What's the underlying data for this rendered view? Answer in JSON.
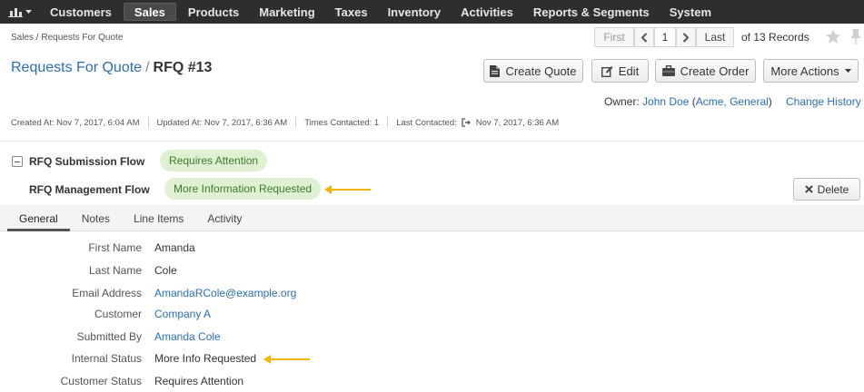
{
  "nav": {
    "logo_icon": "bar-chart-icon",
    "items": [
      "Customers",
      "Sales",
      "Products",
      "Marketing",
      "Taxes",
      "Inventory",
      "Activities",
      "Reports & Segments",
      "System"
    ],
    "active": "Sales"
  },
  "breadcrumb": "Sales / Requests For Quote",
  "pager": {
    "first": "First",
    "current": "1",
    "last": "Last",
    "total": "of 13 Records"
  },
  "title": {
    "parent": "Requests For Quote",
    "separator": "/",
    "current": "RFQ #13"
  },
  "actions": {
    "create_quote": "Create Quote",
    "edit": "Edit",
    "create_order": "Create Order",
    "more_actions": "More Actions"
  },
  "owner": {
    "label": "Owner:",
    "name": "John Doe",
    "org_open": "(",
    "org": "Acme, General",
    "org_close": ")",
    "change_history": "Change History"
  },
  "meta": {
    "created": "Created At: Nov 7, 2017, 6:04 AM",
    "updated": "Updated At: Nov 7, 2017, 6:36 AM",
    "times_contacted": "Times Contacted: 1",
    "last_contacted_label": "Last Contacted:",
    "last_contacted_value": "Nov 7, 2017, 6:36 AM"
  },
  "workflows": [
    {
      "label": "RFQ Submission Flow",
      "status": "Requires Attention"
    },
    {
      "label": "RFQ Management Flow",
      "status": "More Information Requested"
    }
  ],
  "delete_label": "Delete",
  "tabs": [
    "General",
    "Notes",
    "Line Items",
    "Activity"
  ],
  "fields": [
    {
      "label": "First Name",
      "value": "Amanda"
    },
    {
      "label": "Last Name",
      "value": "Cole"
    },
    {
      "label": "Email Address",
      "value": "AmandaRCole@example.org"
    },
    {
      "label": "Customer",
      "value": "Company A"
    },
    {
      "label": "Submitted By",
      "value": "Amanda Cole"
    },
    {
      "label": "Internal Status",
      "value": "More Info Requested"
    },
    {
      "label": "Customer Status",
      "value": "Requires Attention"
    }
  ],
  "colors": {
    "nav_bg": "#2e2e2e",
    "link": "#2a6fb5",
    "badge_bg": "#dff0d3",
    "badge_text": "#3c7b2a",
    "annotation_arrow": "#f4b400"
  }
}
